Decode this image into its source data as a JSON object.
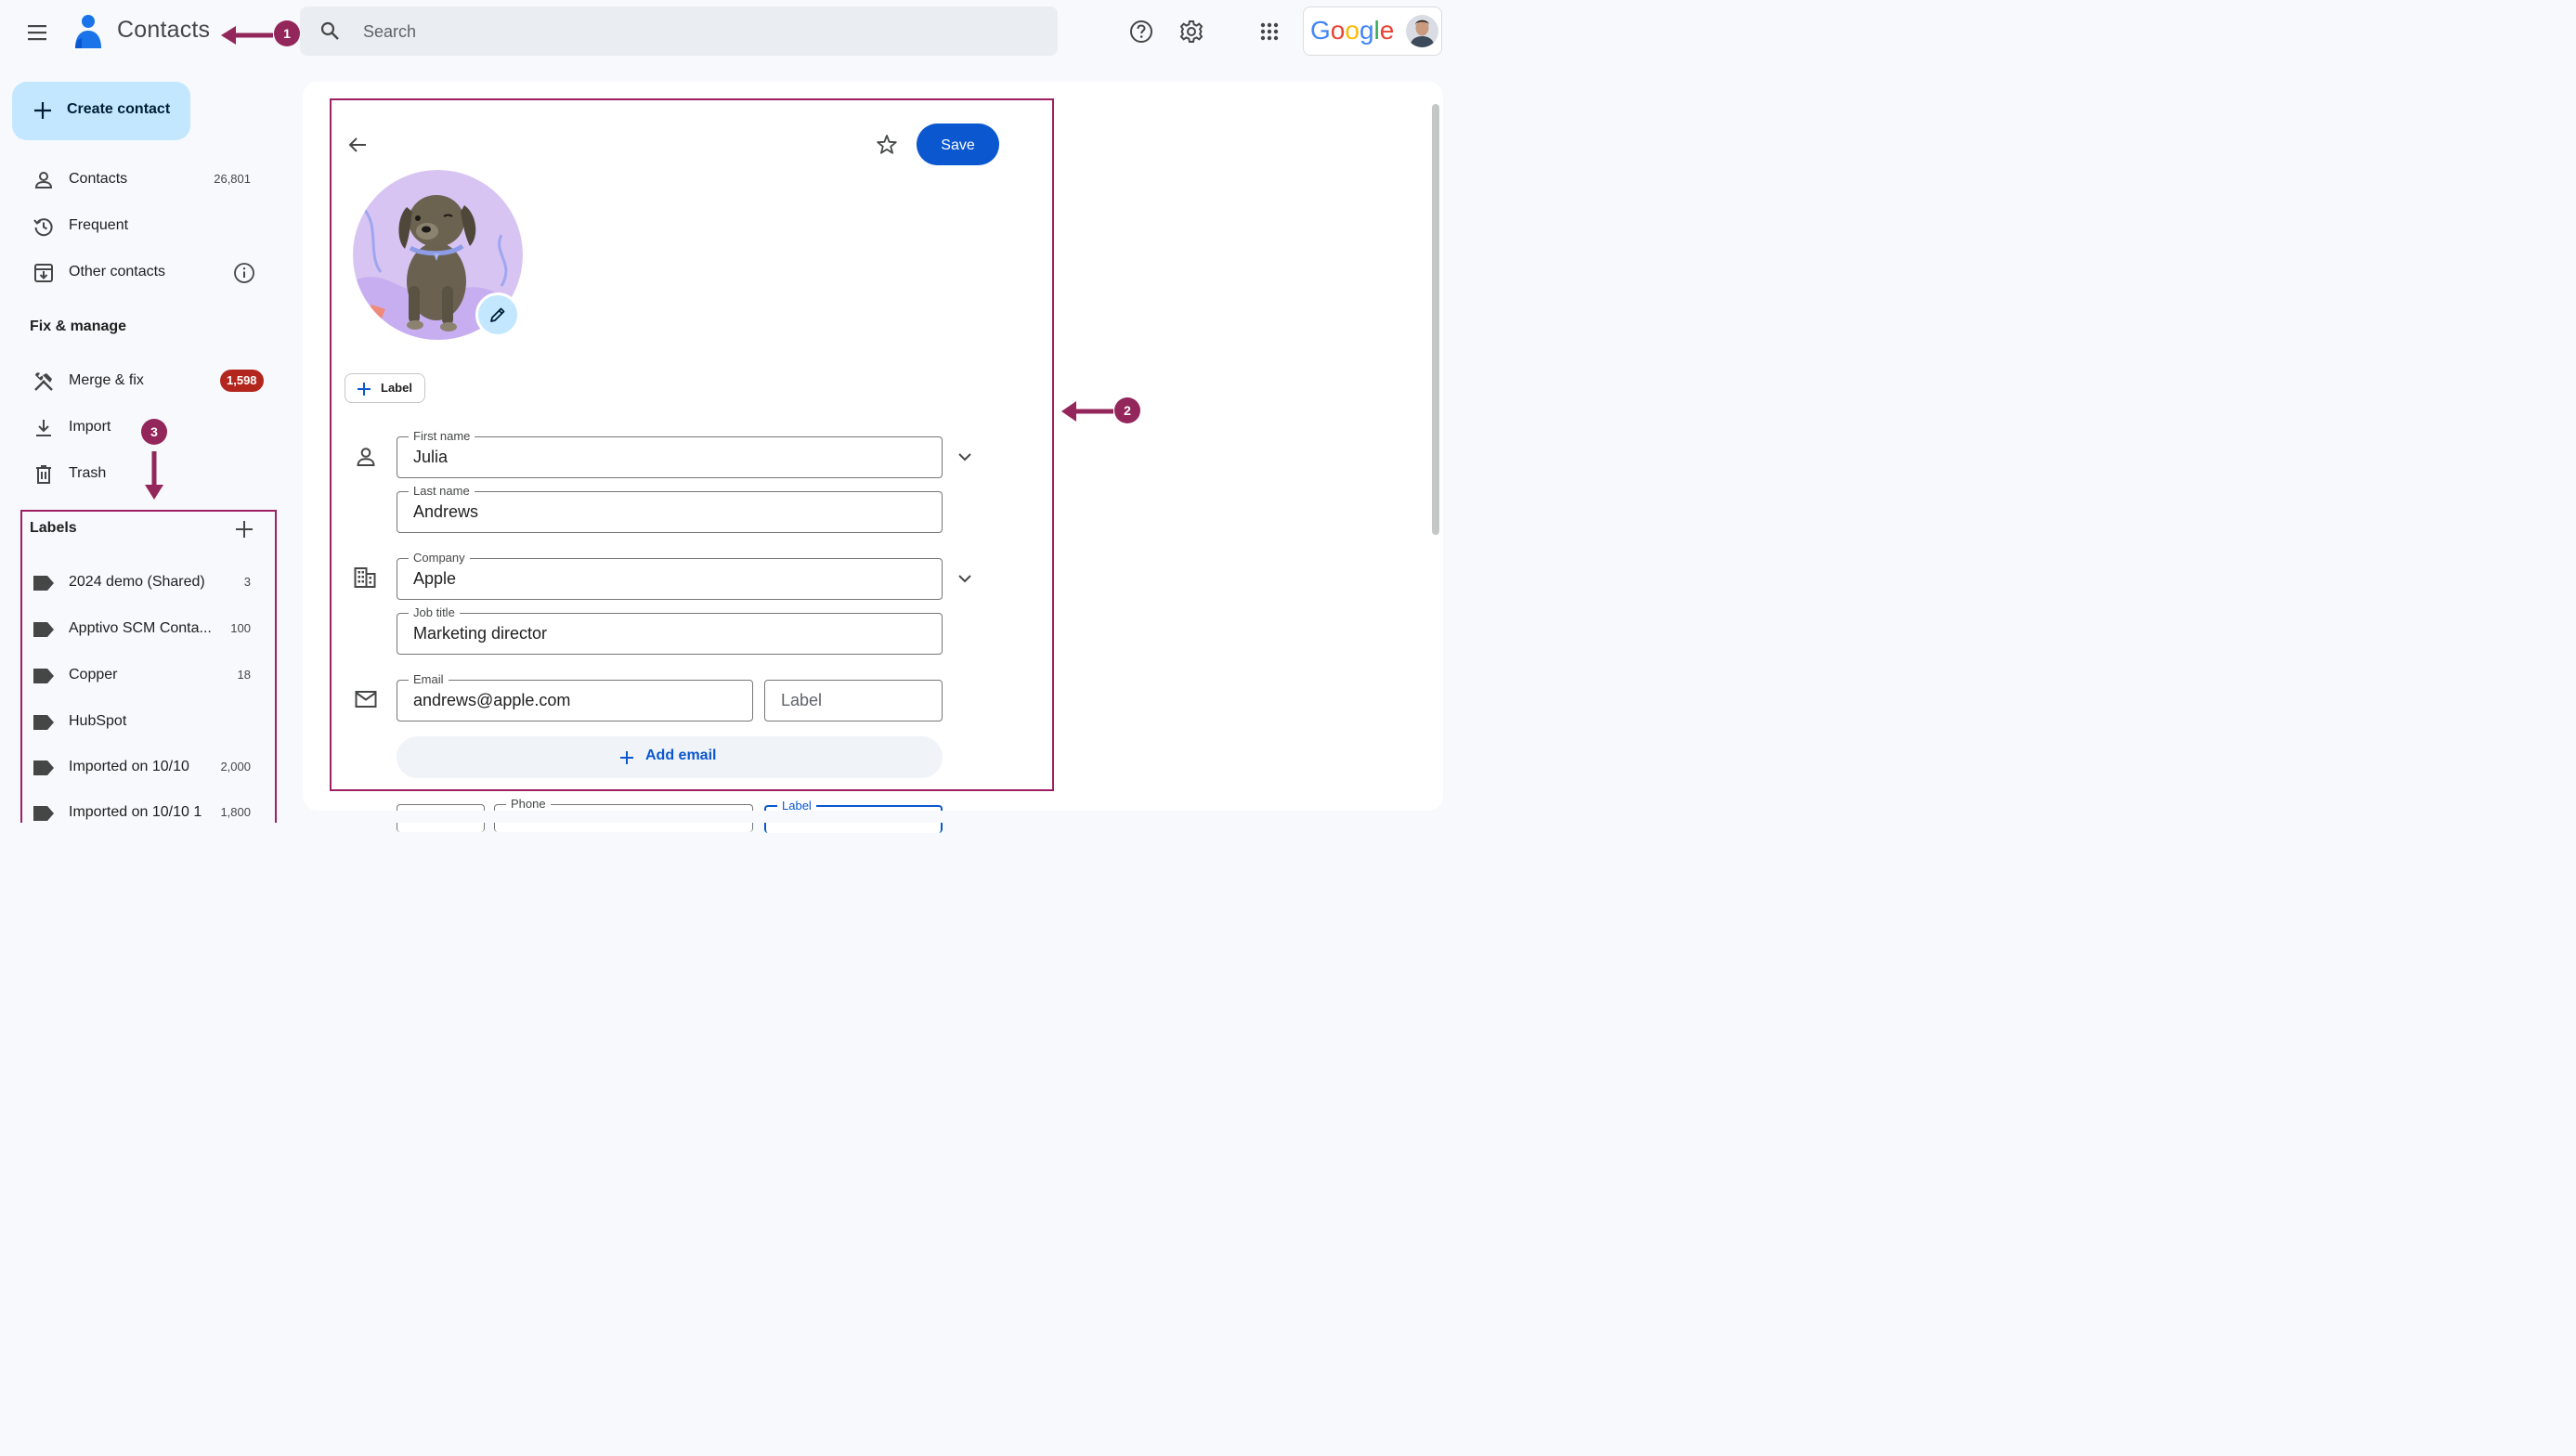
{
  "header": {
    "app_title": "Contacts",
    "search_placeholder": "Search",
    "account_brand": "Google"
  },
  "sidebar": {
    "create_contact": "Create contact",
    "nav": [
      {
        "label": "Contacts",
        "count": "26,801",
        "icon": "person-icon"
      },
      {
        "label": "Frequent",
        "count": "",
        "icon": "history-icon"
      },
      {
        "label": "Other contacts",
        "count": "",
        "icon": "archive-download-icon"
      }
    ],
    "fix_manage_title": "Fix & manage",
    "fix": [
      {
        "label": "Merge & fix",
        "badge": "1,598",
        "icon": "tools-icon"
      },
      {
        "label": "Import",
        "icon": "download-icon"
      },
      {
        "label": "Trash",
        "icon": "trash-icon"
      }
    ],
    "labels_title": "Labels",
    "labels": [
      {
        "label": "2024 demo (Shared)",
        "count": "3"
      },
      {
        "label": "Apptivo SCM Conta...",
        "count": "100"
      },
      {
        "label": "Copper",
        "count": "18"
      },
      {
        "label": "HubSpot",
        "count": ""
      },
      {
        "label": "Imported on 10/10",
        "count": "2,000"
      },
      {
        "label": "Imported on 10/10 1",
        "count": "1,800"
      }
    ]
  },
  "editor": {
    "save": "Save",
    "label_chip": "Label",
    "first_name_label": "First name",
    "first_name": "Julia",
    "last_name_label": "Last name",
    "last_name": "Andrews",
    "company_label": "Company",
    "company": "Apple",
    "job_title_label": "Job title",
    "job_title": "Marketing director",
    "email_label": "Email",
    "email": "andrews@apple.com",
    "email_type_placeholder": "Label",
    "add_email": "Add email",
    "phone_label": "Phone",
    "phone_type_label": "Label"
  },
  "annotations": {
    "marker_1": "1",
    "marker_2": "2",
    "marker_3": "3",
    "accent_color": "#93265b"
  },
  "colors": {
    "primary_blue": "#0b57d0",
    "create_button": "#c2e7ff",
    "badge_red": "#b3261e"
  }
}
